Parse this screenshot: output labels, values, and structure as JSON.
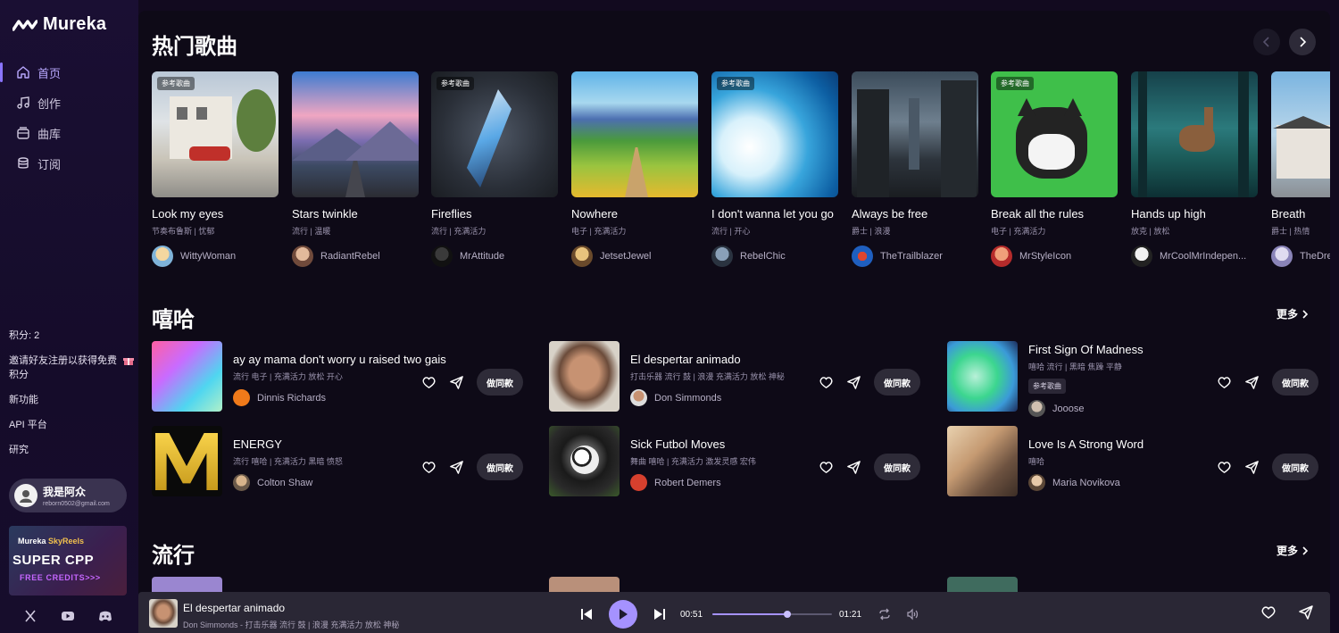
{
  "app": {
    "name": "Mureka"
  },
  "nav": [
    {
      "label": "首页",
      "icon": "home-icon",
      "active": true
    },
    {
      "label": "创作",
      "icon": "music-note-icon"
    },
    {
      "label": "曲库",
      "icon": "library-icon"
    },
    {
      "label": "订阅",
      "icon": "database-icon"
    }
  ],
  "sidebar": {
    "credits": "积分: 2",
    "invite": "邀请好友注册以获得免费积分",
    "new_features": "新功能",
    "api": "API 平台",
    "research": "研究",
    "user": {
      "name": "我是阿众",
      "email": "reborn0502@gmail.com"
    },
    "promo": {
      "brand": "Mureka",
      "partner": "SkyReels",
      "title": "SUPER CPP",
      "subtitle": "FREE CREDITS>>>"
    }
  },
  "hot": {
    "title": "热门歌曲",
    "cards": [
      {
        "title": "Look my eyes",
        "genre": "节奏布鲁斯 | 忧郁",
        "artist": "WittyWoman",
        "ref": true,
        "tag": "参考歌曲"
      },
      {
        "title": "Stars twinkle",
        "genre": "流行 | 温暖",
        "artist": "RadiantRebel",
        "ref": false
      },
      {
        "title": "Fireflies",
        "genre": "流行 | 充满活力",
        "artist": "MrAttitude",
        "ref": true,
        "tag": "参考歌曲"
      },
      {
        "title": "Nowhere",
        "genre": "电子 | 充满活力",
        "artist": "JetsetJewel",
        "ref": false
      },
      {
        "title": "I don't wanna let you go",
        "genre": "流行 | 开心",
        "artist": "RebelChic",
        "ref": true,
        "tag": "参考歌曲"
      },
      {
        "title": "Always be free",
        "genre": "爵士 | 浪漫",
        "artist": "TheTrailblazer",
        "ref": false
      },
      {
        "title": "Break all the rules",
        "genre": "电子 | 充满活力",
        "artist": "MrStyleIcon",
        "ref": true,
        "tag": "参考歌曲"
      },
      {
        "title": "Hands up high",
        "genre": "放克 | 放松",
        "artist": "MrCoolMrIndepen...",
        "ref": false
      },
      {
        "title": "Breath",
        "genre": "爵士 | 热情",
        "artist": "TheDre",
        "ref": false
      }
    ]
  },
  "hiphop": {
    "title": "嘻哈",
    "more": "更多",
    "items": [
      {
        "title": "ay ay mama don't worry u raised two gais",
        "genre": "流行 电子 | 充满活力 放松 开心",
        "artist": "Dinnis Richards",
        "tag": ""
      },
      {
        "title": "El despertar animado",
        "genre": "打击乐器 流行 鼓 | 浪漫 充满活力 放松 神秘",
        "artist": "Don Simmonds",
        "tag": ""
      },
      {
        "title": "First Sign Of Madness",
        "genre": "嘻哈 流行 | 黑暗 焦躁 平静",
        "artist": "Jooose",
        "tag": "参考歌曲"
      },
      {
        "title": "ENERGY",
        "genre": "流行 嘻哈 | 充满活力 黑暗 愤怒",
        "artist": "Colton Shaw",
        "tag": ""
      },
      {
        "title": "Sick Futbol Moves",
        "genre": "舞曲 嘻哈 | 充满活力 激发灵感 宏伟",
        "artist": "Robert Demers",
        "tag": ""
      },
      {
        "title": "Love Is A Strong Word",
        "genre": "嘻哈",
        "artist": "Maria Novikova",
        "tag": ""
      }
    ],
    "make_label": "做同款"
  },
  "pop": {
    "title": "流行",
    "more": "更多"
  },
  "player": {
    "title": "El despertar animado",
    "subtitle": "Don Simmonds - 打击乐器 流行 鼓 | 浪漫 充满活力 放松 神秘",
    "current": "00:51",
    "duration": "01:21",
    "progress": 0.63
  }
}
